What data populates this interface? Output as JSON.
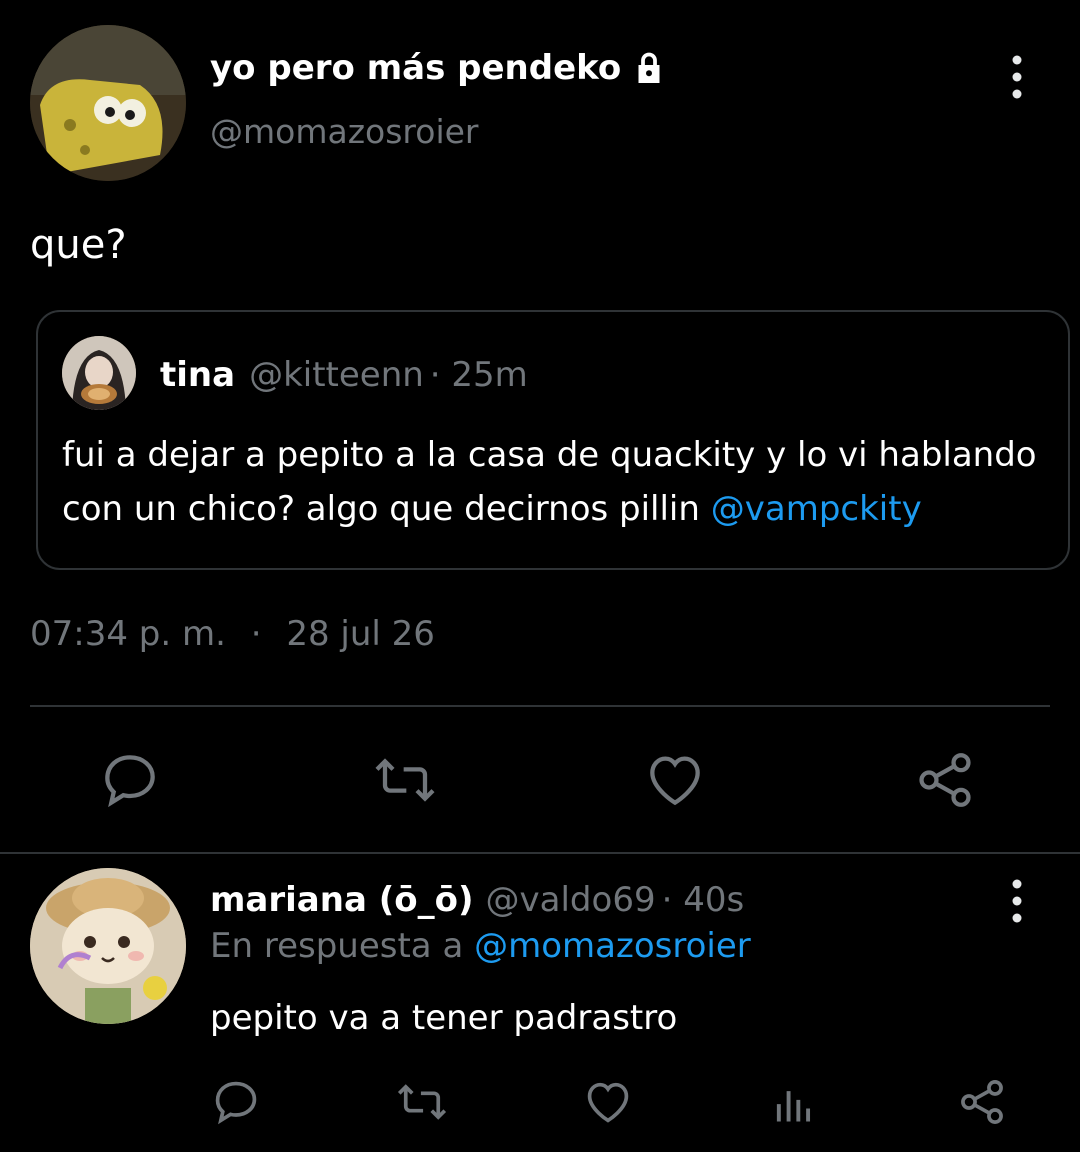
{
  "main_tweet": {
    "display_name": "yo pero más pendeko",
    "handle": "@momazosroier",
    "text": "que?",
    "timestamp_time": "07:34 p. m.",
    "timestamp_sep": "·",
    "timestamp_date": "28 jul 26",
    "icons": {
      "lock": "lock-icon",
      "more": "more-vertical-icon"
    }
  },
  "quoted_tweet": {
    "name": "tina",
    "handle": "@kitteenn",
    "time": "· 25m",
    "text_before": "fui a dejar a pepito a la casa de quackity y lo vi hablando con un chico? algo que decirnos pillin ",
    "mention": "@vampckity"
  },
  "actions": [
    "reply-icon",
    "retweet-icon",
    "like-icon",
    "share-icon"
  ],
  "reply": {
    "display_name": "mariana (ō_ō)",
    "handle": "@valdo69",
    "time": "· 40s",
    "replying_prefix": "En respuesta a",
    "replying_to": "@momazosroier",
    "text": "pepito va a tener padrastro",
    "actions": [
      "reply-icon",
      "retweet-icon",
      "like-icon",
      "analytics-icon",
      "share-icon"
    ]
  },
  "colors": {
    "background": "#000000",
    "text": "#e7e9ea",
    "muted": "#71767b",
    "link": "#1d9bf0",
    "border": "#2f3336"
  }
}
